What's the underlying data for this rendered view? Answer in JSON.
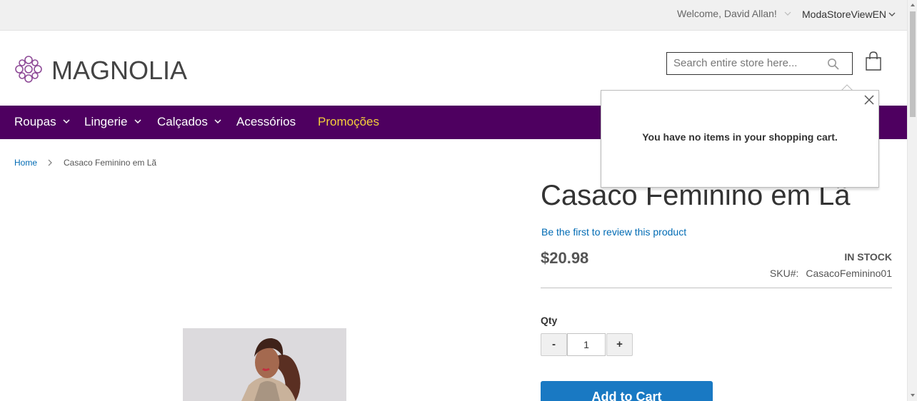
{
  "top_panel": {
    "welcome": "Welcome, David Allan!",
    "store_view": "ModaStoreViewEN"
  },
  "header": {
    "logo_text": "MAGNOLIA",
    "search_placeholder": "Search entire store here...",
    "icons": [
      "logo-flower-icon",
      "search-icon",
      "cart-bag-icon"
    ]
  },
  "nav": {
    "items": [
      {
        "label": "Roupas",
        "has_dropdown": true
      },
      {
        "label": "Lingerie",
        "has_dropdown": true
      },
      {
        "label": "Calçados",
        "has_dropdown": true
      },
      {
        "label": "Acessórios",
        "has_dropdown": false
      },
      {
        "label": "Promoções",
        "has_dropdown": false,
        "highlight": true
      }
    ],
    "background_color": "#4e0060",
    "highlight_color": "#f5d03a"
  },
  "breadcrumb": {
    "home": "Home",
    "current": "Casaco Feminino em Lã"
  },
  "product": {
    "title": "Casaco Feminino em Lã",
    "review_link": "Be the first to review this product",
    "price": "$20.98",
    "stock": "IN STOCK",
    "sku_label": "SKU#:",
    "sku_value": "CasacoFeminino01",
    "qty_label": "Qty",
    "qty_value": "1",
    "qty_minus": "-",
    "qty_plus": "+",
    "add_to_cart": "Add to Cart"
  },
  "minicart": {
    "message": "You have no items in your shopping cart."
  },
  "colors": {
    "link": "#006bb4",
    "button": "#1979c3"
  }
}
